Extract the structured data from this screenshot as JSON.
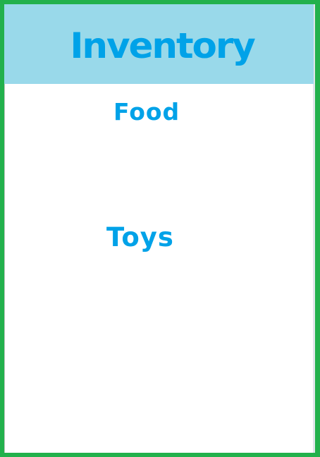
{
  "header": {
    "title": "Inventory"
  },
  "categories": [
    {
      "label": "Food"
    },
    {
      "label": "Toys"
    }
  ],
  "colors": {
    "frame_border": "#22b14c",
    "header_bg": "#99d9ea",
    "text": "#00a2e8",
    "panel_bg": "#ffffff"
  }
}
